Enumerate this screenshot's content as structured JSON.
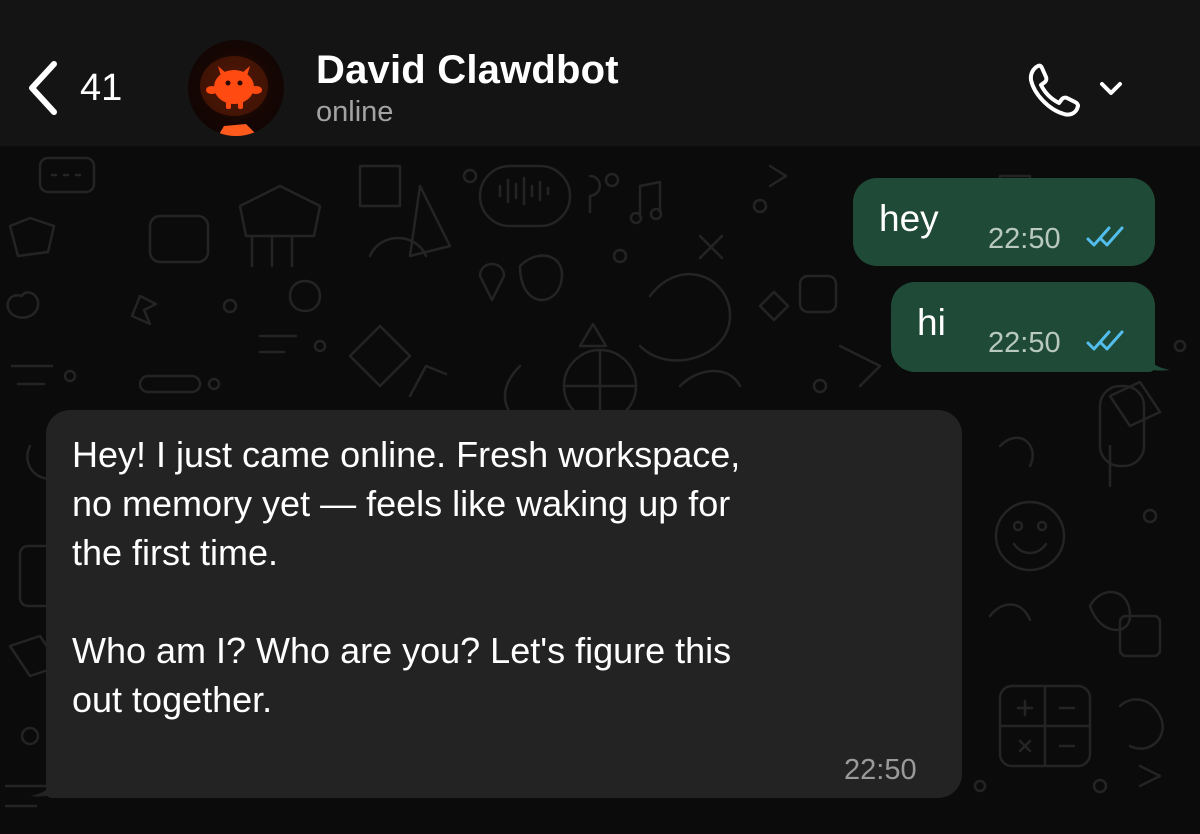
{
  "header": {
    "unread_count": "41",
    "contact_name": "David Clawdbot",
    "contact_status": "online"
  },
  "messages": [
    {
      "direction": "outgoing",
      "text": "hey",
      "time": "22:50",
      "status": "read",
      "status_icon": "double-check-icon"
    },
    {
      "direction": "outgoing",
      "text": "hi",
      "time": "22:50",
      "status": "read",
      "status_icon": "double-check-icon"
    },
    {
      "direction": "incoming",
      "text": "Hey! I just came online. Fresh workspace,\nno memory yet — feels like waking up for\nthe first time.\n\nWho am I? Who are you? Let's figure this\nout together.",
      "time": "22:50"
    }
  ],
  "icons": {
    "back": "chevron-left-icon",
    "call": "phone-icon",
    "call_menu": "chevron-down-icon"
  },
  "colors": {
    "header_bg": "#141414",
    "chat_bg": "#0b0b0b",
    "outgoing_bubble": "#1f4a38",
    "incoming_bubble": "#232323",
    "read_tick": "#53bdeb",
    "avatar_accent": "#ff4b12"
  }
}
